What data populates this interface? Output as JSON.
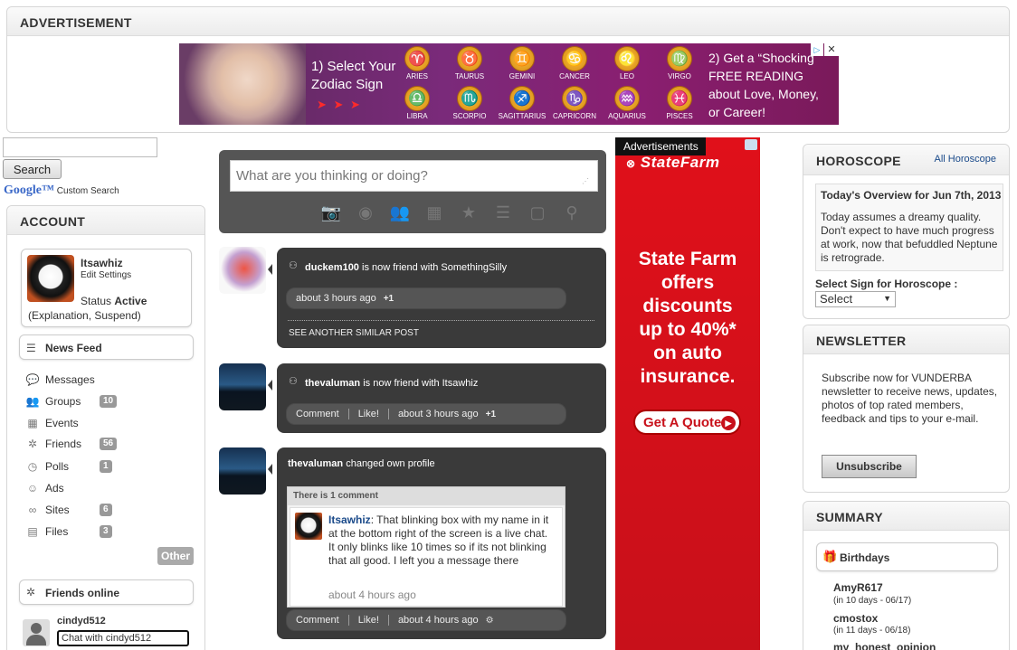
{
  "advert_panel": {
    "title": "ADVERTISEMENT",
    "banner": {
      "step1": "1) Select Your Zodiac Sign",
      "step2": "2) Get a “Shocking FREE READING about Love, Money, or Career!",
      "signs": [
        "ARIES",
        "TAURUS",
        "GEMINI",
        "CANCER",
        "LEO",
        "VIRGO",
        "LIBRA",
        "SCORPIO",
        "SAGITTARIUS",
        "CAPRICORN",
        "AQUARIUS",
        "PISCES"
      ],
      "glyphs": [
        "♈",
        "♉",
        "♊",
        "♋",
        "♌",
        "♍",
        "♎",
        "♏",
        "♐",
        "♑",
        "♒",
        "♓"
      ],
      "arrows": "➤ ➤ ➤",
      "info_label": "▷",
      "close_label": "✕"
    }
  },
  "search": {
    "value": "",
    "button": "Search",
    "google_label": "Google™",
    "custom": "Custom Search"
  },
  "account": {
    "title": "ACCOUNT",
    "username": "Itsawhiz",
    "edit": "Edit Settings",
    "status_label": "Status",
    "status_value": "Active",
    "status_links": "(Explanation, Suspend)",
    "news_feed": "News Feed",
    "nav": [
      {
        "label": "Messages",
        "icon": "💬",
        "count": ""
      },
      {
        "label": "Groups",
        "icon": "👥",
        "count": "10"
      },
      {
        "label": "Events",
        "icon": "▦",
        "count": ""
      },
      {
        "label": "Friends",
        "icon": "✲",
        "count": "56"
      },
      {
        "label": "Polls",
        "icon": "◷",
        "count": "1"
      },
      {
        "label": "Ads",
        "icon": "☺",
        "count": ""
      },
      {
        "label": "Sites",
        "icon": "∞",
        "count": "6"
      },
      {
        "label": "Files",
        "icon": "▤",
        "count": "3"
      }
    ],
    "other": "Other",
    "friends_online": "Friends online",
    "online_user": "cindyd512",
    "chat_label": "Chat with cindyd512"
  },
  "composer": {
    "placeholder": "What are you thinking or doing?",
    "tools": [
      "📷",
      "◉",
      "👥",
      "▦",
      "★",
      "☰",
      "▢",
      "⚲"
    ]
  },
  "feed": [
    {
      "user": "duckem100",
      "text": "is now friend with SomethingSilly",
      "time": "about 3 hours ago",
      "plus": "+1",
      "similar": "SEE ANOTHER SIMILAR POST"
    },
    {
      "user": "thevaluman",
      "text": "is now friend with Itsawhiz",
      "comment": "Comment",
      "like": "Like!",
      "time": "about 3 hours ago",
      "plus": "+1"
    },
    {
      "user": "thevaluman",
      "text": "changed own profile",
      "comments_header": "There is 1 comment",
      "comment_user": "Itsawhiz",
      "comment_text": ": That blinking box with my name in it at the bottom right of the screen is a live chat. It only blinks like 10 times so if its not blinking that all good. I left you a message there",
      "comment_time": "about 4 hours ago",
      "comment": "Comment",
      "like": "Like!",
      "time": "about 4 hours ago"
    }
  ],
  "sidead": {
    "label": "Advertisements",
    "brand": "StateFarm",
    "headline1": "State Farm",
    "headline2": "offers discounts",
    "headline3": "up to 40%*",
    "headline4": "on auto",
    "headline5": "insurance.",
    "cta": "Get A Quote"
  },
  "horoscope": {
    "title": "HOROSCOPE",
    "all_link": "All Horoscope",
    "overview_title": "Today's Overview for Jun 7th, 2013",
    "overview_text": "Today assumes a dreamy quality. Don't expect to have much progress at work, now that befuddled Neptune is retrograde.",
    "select_label": "Select Sign for Horoscope :",
    "select_value": "Select"
  },
  "newsletter": {
    "title": "NEWSLETTER",
    "text": "Subscribe now for VUNDERBA newsletter to receive news, updates, photos of top rated members, feedback and tips to your e-mail.",
    "button": "Unsubscribe"
  },
  "summary": {
    "title": "SUMMARY",
    "birthdays": "Birthdays",
    "people": [
      {
        "name": "AmyR617",
        "when": "(in 10 days - 06/17)"
      },
      {
        "name": "cmostox",
        "when": "(in 11 days - 06/18)"
      },
      {
        "name": "my_honest_opinion",
        "when": ""
      }
    ]
  }
}
